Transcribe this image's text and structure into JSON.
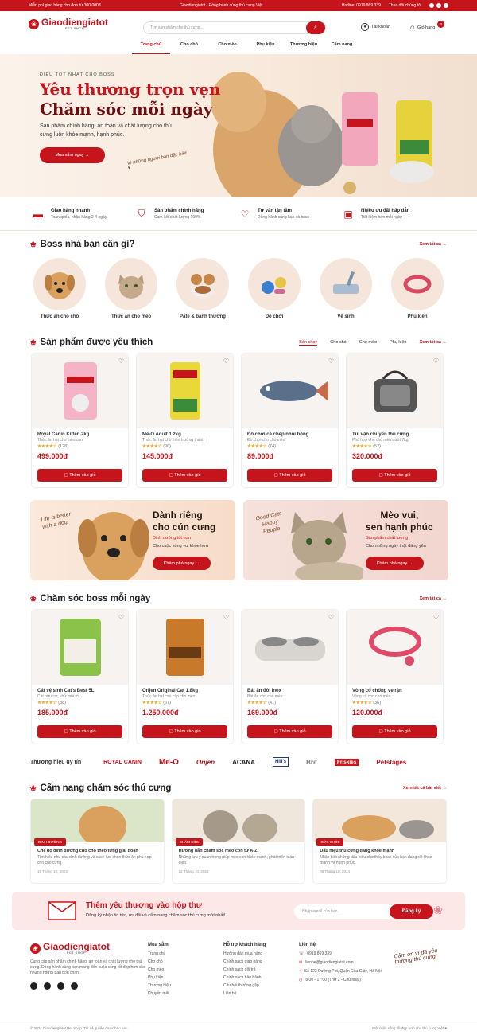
{
  "topbar": {
    "left": "Miễn phí giao hàng cho đơn từ 300.000đ",
    "center": "Giaodiengiatot - Đồng hành cùng thú cưng Việt",
    "hotline": "Hotline: 0919 869 339",
    "follow": "Theo dõi chúng tôi"
  },
  "header": {
    "logo": "Giaodiengiatot",
    "logo_sub": "PET SHOP",
    "search_placeholder": "Tìm sản phẩm cho thú cưng...",
    "account": "Tài khoản",
    "cart": "Giỏ hàng",
    "cart_count": "0"
  },
  "nav": [
    "Trang chủ",
    "Cho chó",
    "Cho mèo",
    "Phụ kiện",
    "Thương hiệu",
    "Cẩm nang"
  ],
  "hero": {
    "kicker": "ĐIỀU TỐT NHẤT CHO BOSS",
    "line1": "Yêu thương trọn vẹn",
    "line2": "Chăm sóc mỗi ngày",
    "desc": "Sản phẩm chính hãng, an toàn và chất lượng cho thú cưng luôn khỏe mạnh, hạnh phúc.",
    "cta": "Mua sắm ngay →",
    "script": "Vì những người bạn đặc biệt ♥"
  },
  "features": [
    {
      "t": "Giao hàng nhanh",
      "d": "Toàn quốc, nhận hàng 2-4 ngày",
      "icon": "truck-icon"
    },
    {
      "t": "Sản phẩm chính hãng",
      "d": "Cam kết chất lượng 100%",
      "icon": "shield-icon"
    },
    {
      "t": "Tư vấn tận tâm",
      "d": "Đồng hành cùng bạn và boss",
      "icon": "heart-icon"
    },
    {
      "t": "Nhiều ưu đãi hấp dẫn",
      "d": "Tiết kiệm hơn mỗi ngày",
      "icon": "gift-icon"
    }
  ],
  "boss": {
    "title": "Boss nhà bạn cần gì?",
    "see": "Xem tất cả →",
    "items": [
      "Thức ăn cho chó",
      "Thức ăn cho mèo",
      "Pate & bánh thưởng",
      "Đồ chơi",
      "Vệ sinh",
      "Phụ kiện"
    ]
  },
  "fav": {
    "title": "Sản phẩm được yêu thích",
    "tabs": [
      "Bán chạy",
      "Cho chó",
      "Cho mèo",
      "Phụ kiện"
    ],
    "see": "Xem tất cả →",
    "items": [
      {
        "nm": "Royal Canin Kitten 2kg",
        "sb": "Thức ăn hạt cho mèo con",
        "stars": "★★★★☆",
        "rc": "(128)",
        "pr": "499.000đ"
      },
      {
        "nm": "Me-O Adult 1.2kg",
        "sb": "Thức ăn hạt cho mèo trưởng thành",
        "stars": "★★★★☆",
        "rc": "(96)",
        "pr": "145.000đ"
      },
      {
        "nm": "Đồ chơi cá chép nhồi bông",
        "sb": "Đồ chơi cho chó mèo",
        "stars": "★★★★☆",
        "rc": "(74)",
        "pr": "89.000đ"
      },
      {
        "nm": "Túi vận chuyển thú cưng",
        "sb": "Phù hợp cho chó mèo dưới 7kg",
        "stars": "★★★★☆",
        "rc": "(52)",
        "pr": "320.000đ"
      }
    ]
  },
  "add_label": "Thêm vào giỏ",
  "banners": [
    {
      "hand": "Life is better with a dog",
      "t1": "Dành riêng",
      "t2": "cho cún cưng",
      "s": "Dinh dưỡng tốt hơn",
      "d": "Cho cuộc sống vui khỏe hơn",
      "b": "Khám phá ngay →"
    },
    {
      "hand": "Good Cats Happy People",
      "t1": "Mèo vui,",
      "t2": "sen hạnh phúc",
      "s": "Sản phẩm chất lượng",
      "d": "Cho những ngày thật đáng yêu",
      "b": "Khám phá ngay →"
    }
  ],
  "care": {
    "title": "Chăm sóc boss mỗi ngày",
    "see": "Xem tất cả →",
    "items": [
      {
        "nm": "Cát vệ sinh Cat's Best 5L",
        "sb": "Cát hữu cơ, khử mùi tốt",
        "stars": "★★★★☆",
        "rc": "(88)",
        "pr": "185.000đ"
      },
      {
        "nm": "Orijen Original Cat 1.8kg",
        "sb": "Thức ăn hạt cao cấp cho mèo",
        "stars": "★★★★☆",
        "rc": "(67)",
        "pr": "1.250.000đ"
      },
      {
        "nm": "Bát ăn đôi inox",
        "sb": "Bát ăn cho chó mèo",
        "stars": "★★★★☆",
        "rc": "(41)",
        "pr": "169.000đ"
      },
      {
        "nm": "Vòng cổ chống ve rận",
        "sb": "Vòng cổ cho chó mèo",
        "stars": "★★★★☆",
        "rc": "(36)",
        "pr": "120.000đ"
      }
    ]
  },
  "brands": {
    "label": "Thương hiệu uy tín",
    "list": [
      "ROYAL CANIN",
      "Me-O",
      "Orijen",
      "ACANA",
      "Hill's",
      "Brit",
      "Friskies",
      "Petstages"
    ]
  },
  "guide": {
    "title": "Cẩm nang chăm sóc thú cưng",
    "see": "Xem tất cả bài viết →",
    "posts": [
      {
        "tag": "DINH DƯỠNG",
        "t": "Chế độ dinh dưỡng cho chó theo từng giai đoạn",
        "d": "Tìm hiểu nhu cầu dinh dưỡng và cách lựa chọn thức ăn phù hợp cho chó cưng.",
        "dt": "15 Tháng 10, 2024"
      },
      {
        "tag": "CHĂM SÓC",
        "t": "Hướng dẫn chăm sóc mèo con từ A-Z",
        "d": "Những lưu ý quan trọng giúp mèo con khỏe mạnh, phát triển toàn diện.",
        "dt": "12 Tháng 10, 2024"
      },
      {
        "tag": "SỨC KHỎE",
        "t": "Dấu hiệu thú cưng đang khỏe mạnh",
        "d": "Nhận biết những dấu hiệu cho thấy boss của bạn đang rất khỏe mạnh và hạnh phúc.",
        "dt": "08 Tháng 10, 2024"
      }
    ]
  },
  "newsletter": {
    "t": "Thêm yêu thương vào hộp thư",
    "d": "Đăng ký nhận tin tức, ưu đãi và cẩm nang chăm sóc thú cưng mới nhất!",
    "ph": "Nhập email của bạn...",
    "b": "Đăng ký"
  },
  "footer": {
    "desc": "Cung cấp sản phẩm chính hãng, an toàn và chất lượng cho thú cưng. Đồng hành cùng bạn mang đến cuộc sống tốt đẹp hơn cho những người bạn bốn chân.",
    "shop_h": "Mua sắm",
    "shop": [
      "Trang chủ",
      "Cho chó",
      "Cho mèo",
      "Phụ kiện",
      "Thương hiệu",
      "Khuyến mãi"
    ],
    "help_h": "Hỗ trợ khách hàng",
    "help": [
      "Hướng dẫn mua hàng",
      "Chính sách giao hàng",
      "Chính sách đổi trả",
      "Chính sách bảo hành",
      "Câu hỏi thường gặp",
      "Liên hệ"
    ],
    "contact_h": "Liên hệ",
    "phone": "0919 869 339",
    "email": "lienhe@giaodiengiatot.com",
    "addr": "Số 123 Đường Pet, Quận Cầu Giấy, Hà Nội",
    "hours": "8:00 - 17:00 (Thứ 2 - Chủ nhật)",
    "hand": "Cảm ơn vì đã yêu thương thú cưng!"
  },
  "copyright": "© 2024 Giaodiengiatot Pet Shop. Tất cả quyền được bảo lưu.",
  "tagline": "Một cuộc sống tốt đẹp hơn cho thú cưng Việt ♥"
}
